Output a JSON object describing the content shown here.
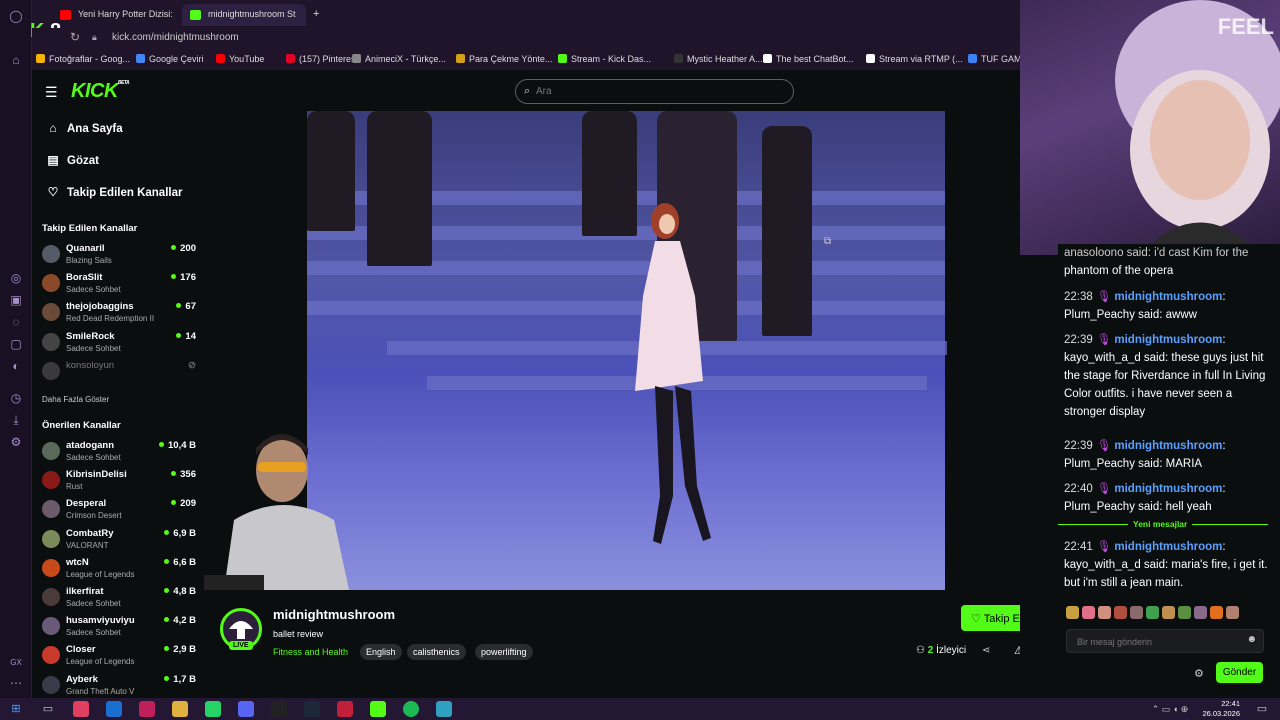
{
  "browser": {
    "tabs": [
      {
        "label": "Yeni Harry Potter Dizisi: Bi",
        "icon_color": "#ff0000"
      },
      {
        "label": "midnightmushroom St",
        "icon_color": "#53fc18"
      }
    ],
    "new_tab": "+",
    "url": "kick.com/midnightmushroom",
    "badge_number": "8",
    "bookmarks": [
      {
        "label": "Fotoğraflar - Goog...",
        "color": "#f4b400"
      },
      {
        "label": "Google Çeviri",
        "color": "#4285f4"
      },
      {
        "label": "YouTube",
        "color": "#ff0000"
      },
      {
        "label": "(157) Pinterest",
        "color": "#e60023"
      },
      {
        "label": "AnimeciX - Türkçe...",
        "color": "#888888"
      },
      {
        "label": "Para Çekme Yönte...",
        "color": "#d4a017"
      },
      {
        "label": "Stream - Kick Das...",
        "color": "#53fc18"
      },
      {
        "label": "Mystic Heather A...",
        "color": "#333333"
      },
      {
        "label": "The best ChatBot...",
        "color": "#ffffff"
      },
      {
        "label": "Stream via RTMP (...",
        "color": "#ffffff"
      },
      {
        "label": "TUF GAM",
        "color": "#3b82f6"
      }
    ]
  },
  "header": {
    "logo": "KICK",
    "logo_sup": "BETA",
    "search_placeholder": "Ara"
  },
  "sidebar": {
    "nav": [
      {
        "label": "Ana Sayfa",
        "icon": "home-icon"
      },
      {
        "label": "Gözat",
        "icon": "browse-icon"
      },
      {
        "label": "Takip Edilen Kanallar",
        "icon": "heart-icon"
      }
    ],
    "followed_title": "Takip Edilen Kanallar",
    "followed": [
      {
        "name": "Quanaril",
        "sub": "Blazing Sails",
        "viewers": "200",
        "color": "#555b66"
      },
      {
        "name": "BoraSlit",
        "sub": "Sadece Sohbet",
        "viewers": "176",
        "color": "#8a4a2a"
      },
      {
        "name": "thejojobaggins",
        "sub": "Red Dead Redemption II",
        "viewers": "67",
        "color": "#6a4a3a"
      },
      {
        "name": "SmileRock",
        "sub": "Sadece Sohbet",
        "viewers": "14",
        "color": "#444444"
      },
      {
        "name": "konsoloyun",
        "sub": "",
        "viewers": "",
        "color": "#3a3a3a"
      }
    ],
    "show_more": "Daha Fazla Göster",
    "recommended_title": "Önerilen Kanallar",
    "recommended": [
      {
        "name": "atadogann",
        "sub": "Sadece Sohbet",
        "viewers": "10,4 B",
        "color": "#5a6a5a"
      },
      {
        "name": "KibrisinDelisi",
        "sub": "Rust",
        "viewers": "356",
        "color": "#8a1a1a"
      },
      {
        "name": "Desperal",
        "sub": "Crimson Desert",
        "viewers": "209",
        "color": "#6a5a6a"
      },
      {
        "name": "CombatRy",
        "sub": "VALORANT",
        "viewers": "6,9 B",
        "color": "#7a8a5a"
      },
      {
        "name": "wtcN",
        "sub": "League of Legends",
        "viewers": "6,6 B",
        "color": "#c84a1a"
      },
      {
        "name": "ilkerfirat",
        "sub": "Sadece Sohbet",
        "viewers": "4,8 B",
        "color": "#4a3a3a"
      },
      {
        "name": "husamviyuviyu",
        "sub": "Sadece Sohbet",
        "viewers": "4,2 B",
        "color": "#6a5a7a"
      },
      {
        "name": "Closer",
        "sub": "League of Legends",
        "viewers": "2,9 B",
        "color": "#c83a2a"
      },
      {
        "name": "Ayberk",
        "sub": "Grand Theft Auto V",
        "viewers": "1,7 B",
        "color": "#3a3a4a"
      }
    ]
  },
  "stream": {
    "channel": "midnightmushroom",
    "title": "ballet review",
    "live": "LIVE",
    "category": "Fitness and Health",
    "tags": [
      "English",
      "calisthenics",
      "powerlifting"
    ],
    "follow_label": "Takip Et",
    "viewers_count": "2",
    "viewers_label": "İzleyici"
  },
  "chat": {
    "partial_top": "anasoloono said: i'd cast Kim for the phantom of the opera",
    "partial_top_visible": "phantom of the opera",
    "messages": [
      {
        "time": "22:38",
        "user": "midnightmushroom",
        "text": "Plum_Peachy said: awww"
      },
      {
        "time": "22:39",
        "user": "midnightmushroom",
        "text": "kayo_with_a_d said: these guys just hit the stage for Riverdance in full In Living Color outfits. i have never seen a stronger display"
      },
      {
        "time": "22:39",
        "user": "midnightmushroom",
        "text": "Plum_Peachy said: MARIA"
      },
      {
        "time": "22:40",
        "user": "midnightmushroom",
        "text": "Plum_Peachy said: hell yeah"
      },
      {
        "time": "22:41",
        "user": "midnightmushroom",
        "text": "kayo_with_a_d said: maria's fire, i get it. but i'm still a jean main."
      }
    ],
    "new_messages": "Yeni mesajlar",
    "input_placeholder": "Bir mesaj gönderin",
    "send_label": "Gönder",
    "cam_overlay": "FEEL"
  },
  "taskbar": {
    "time": "22:41",
    "date": "26.03.2026"
  },
  "colors": {
    "accent": "#53fc18",
    "username": "#5aa0ff",
    "bg": "#0b0e0f"
  }
}
